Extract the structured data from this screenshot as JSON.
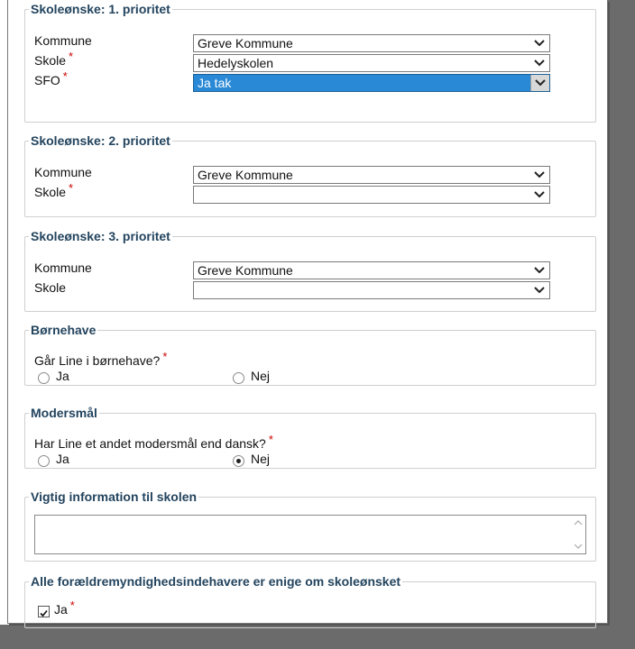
{
  "sections": {
    "p1": {
      "legend": "Skoleønske: 1. prioritet",
      "kommune_label": "Kommune",
      "kommune_value": "Greve Kommune",
      "skole_label": "Skole",
      "skole_value": "Hedelyskolen",
      "sfo_label": "SFO",
      "sfo_value": "Ja tak"
    },
    "p2": {
      "legend": "Skoleønske: 2. prioritet",
      "kommune_label": "Kommune",
      "kommune_value": "Greve Kommune",
      "skole_label": "Skole",
      "skole_value": ""
    },
    "p3": {
      "legend": "Skoleønske: 3. prioritet",
      "kommune_label": "Kommune",
      "kommune_value": "Greve Kommune",
      "skole_label": "Skole",
      "skole_value": ""
    },
    "bornehave": {
      "legend": "Børnehave",
      "question": "Går Line i børnehave?",
      "option_ja": "Ja",
      "option_nej": "Nej",
      "selected": "none"
    },
    "modersmal": {
      "legend": "Modersmål",
      "question": "Har Line et andet modersmål end dansk?",
      "option_ja": "Ja",
      "option_nej": "Nej",
      "selected": "Nej"
    },
    "info": {
      "legend": "Vigtig information til skolen",
      "value": ""
    },
    "enige": {
      "legend": "Alle forældremyndighedsindehavere er enige om skoleønsket",
      "checkbox_label": "Ja",
      "checked": true
    }
  },
  "required_marker": "*",
  "colors": {
    "legend": "#23445e",
    "required": "#cc0000",
    "selected_option_bg": "#2a89d6"
  }
}
